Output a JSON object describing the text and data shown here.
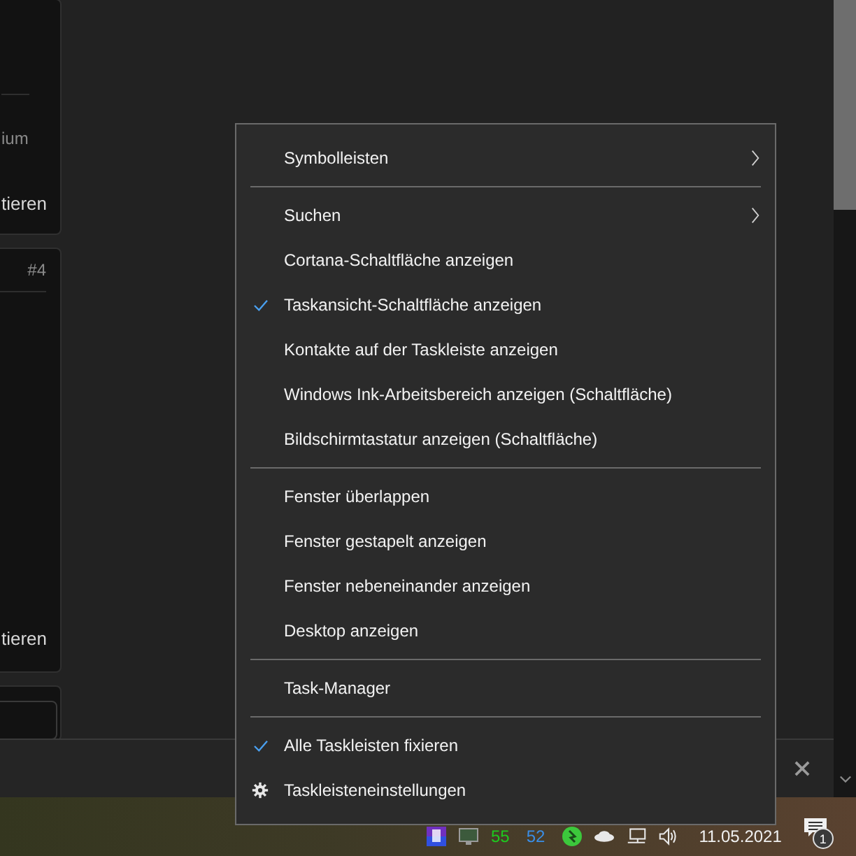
{
  "left_cards": [
    {
      "texts": [
        {
          "text": "ium",
          "kind": "muted"
        },
        {
          "text": "tieren",
          "kind": "action"
        }
      ]
    },
    {
      "header": "#4",
      "texts": [
        {
          "text": "tieren",
          "kind": "action"
        }
      ]
    }
  ],
  "context_menu": [
    {
      "kind": "submenu",
      "label": "Symbolleisten",
      "checked": false
    },
    {
      "kind": "separator"
    },
    {
      "kind": "submenu",
      "label": "Suchen",
      "checked": false
    },
    {
      "kind": "item",
      "label": "Cortana-Schaltfläche anzeigen",
      "checked": false
    },
    {
      "kind": "item",
      "label": "Taskansicht-Schaltfläche anzeigen",
      "checked": true
    },
    {
      "kind": "item",
      "label": "Kontakte auf der Taskleiste anzeigen",
      "checked": false
    },
    {
      "kind": "item",
      "label": "Windows Ink-Arbeitsbereich anzeigen (Schaltfläche)",
      "checked": false
    },
    {
      "kind": "item",
      "label": "Bildschirmtastatur anzeigen (Schaltfläche)",
      "checked": false
    },
    {
      "kind": "separator"
    },
    {
      "kind": "item",
      "label": "Fenster überlappen",
      "checked": false
    },
    {
      "kind": "item",
      "label": "Fenster gestapelt anzeigen",
      "checked": false
    },
    {
      "kind": "item",
      "label": "Fenster nebeneinander anzeigen",
      "checked": false
    },
    {
      "kind": "item",
      "label": "Desktop anzeigen",
      "checked": false
    },
    {
      "kind": "separator"
    },
    {
      "kind": "item",
      "label": "Task-Manager",
      "checked": false
    },
    {
      "kind": "separator"
    },
    {
      "kind": "item",
      "label": "Alle Taskleisten fixieren",
      "checked": true
    },
    {
      "kind": "settings",
      "label": "Taskleisteneinstellungen",
      "checked": false
    }
  ],
  "tray": {
    "readings": [
      {
        "text": "55",
        "color": "#1ec81e"
      },
      {
        "text": "52",
        "color": "#3a8ee6"
      }
    ],
    "date": "11.05.2021",
    "notification_count": "1"
  }
}
